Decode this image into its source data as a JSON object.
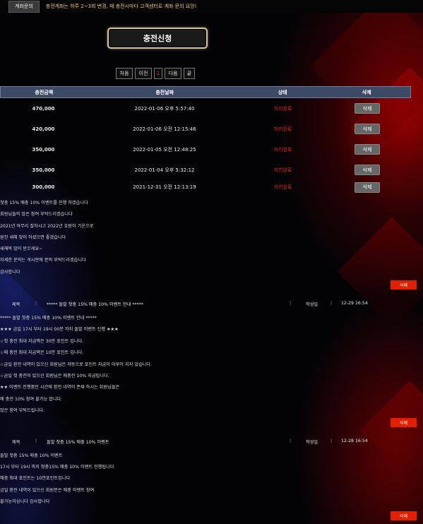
{
  "topbar": {
    "button_label": "계좌문의",
    "notice_text": "충전계좌는 하루 2~3회 변경, 매 충전시마다 고객센터로 계좌 문의 요망!"
  },
  "charge_button_label": "충전신청",
  "pager": {
    "first": "처음",
    "prev": "이전",
    "current": "1",
    "next": "다음",
    "last": "끝"
  },
  "table": {
    "headers": [
      "충전금액",
      "충전날짜",
      "상태",
      "삭제"
    ],
    "rows": [
      {
        "amount": "470,000",
        "date": "2022-01-06 오후 5:57:40",
        "status": "처리완료",
        "action": "삭제"
      },
      {
        "amount": "420,000",
        "date": "2022-01-06 오전 12:15:46",
        "status": "처리완료",
        "action": "삭제"
      },
      {
        "amount": "350,000",
        "date": "2022-01-05 오전 12:48:25",
        "status": "처리완료",
        "action": "삭제"
      },
      {
        "amount": "350,000",
        "date": "2022-01-04 오후 5:32:12",
        "status": "처리완료",
        "action": "삭제"
      },
      {
        "amount": "300,000",
        "date": "2021-12-31 오전 12:13:19",
        "status": "처리완료",
        "action": "삭제"
      }
    ]
  },
  "notice1": {
    "lines": [
      "첫충 15% 매충 10% 이벤트를 진행 하겠습니다",
      "회원님들의 많은 참여 부탁드리겠습니다",
      "2021년 마무리 잘하시고 2022년 호랑이 기운으로",
      "원찬 새해 맞이 하셨으면 좋겠습니다",
      "새해복 많이 받으세요~",
      "자세한 문의는 게시판에 문의 부탁드리겠습니다",
      "감사합니다"
    ],
    "delete_label": "삭제"
  },
  "notice2": {
    "title_label": "제목",
    "title": "***** 돌발 첫충 15% 매충 10% 이벤트 안내 *****",
    "author_label": "작성일",
    "date": "12-29 16:54",
    "lines": [
      "***** 돌발 첫충 15% 매충 10% 이벤트 안내 *****",
      "★★★ 금일 17시 부터 19시 00분 까지 돌발 이벤트 진행 ★★★",
      "☆첫 충전 최대 지급액은 30만 포인트 입니다.",
      "☆매 충전 최대 지급액은 10만 포인트 입니다.",
      "☆금일 환전 내역이 있으신 회원님은 자동으로 포인트 지급이 이루어 지지 않습니다.",
      "☆금일 첫 충전이 있으신 회원님은 매충전 10% 지급됩니다.",
      "★★ 이벤트 진행중인 시간에 환전 내역이 존재 하시는 회원님들은",
      "매 충전 10% 참여 불가능 합니다.",
      "많은 참여 부탁드립니다."
    ],
    "delete_label": "삭제"
  },
  "notice3": {
    "title_label": "제목",
    "title": "돌발 첫충 15% 매충 10% 이벤트",
    "author_label": "작성일",
    "date": "12-28 16:54",
    "lines": [
      "돌발 첫충 15% 매충 10% 이벤트",
      "17시 부터 19시 까지 첫충15% 매충 10% 이벤트 진행됩니다",
      "매충 최대 포인트는 10만포인트입니다",
      "금일 환전 내역이 있으신 회원분은 매충 이벤트 참여",
      "불가능하십니다 감사합니다"
    ],
    "delete_label": "삭제"
  },
  "colors": {
    "accent_red": "#e02000",
    "status_red": "#e02020",
    "header_blue": "#3c4a66",
    "gold_border": "#d8c49a"
  }
}
